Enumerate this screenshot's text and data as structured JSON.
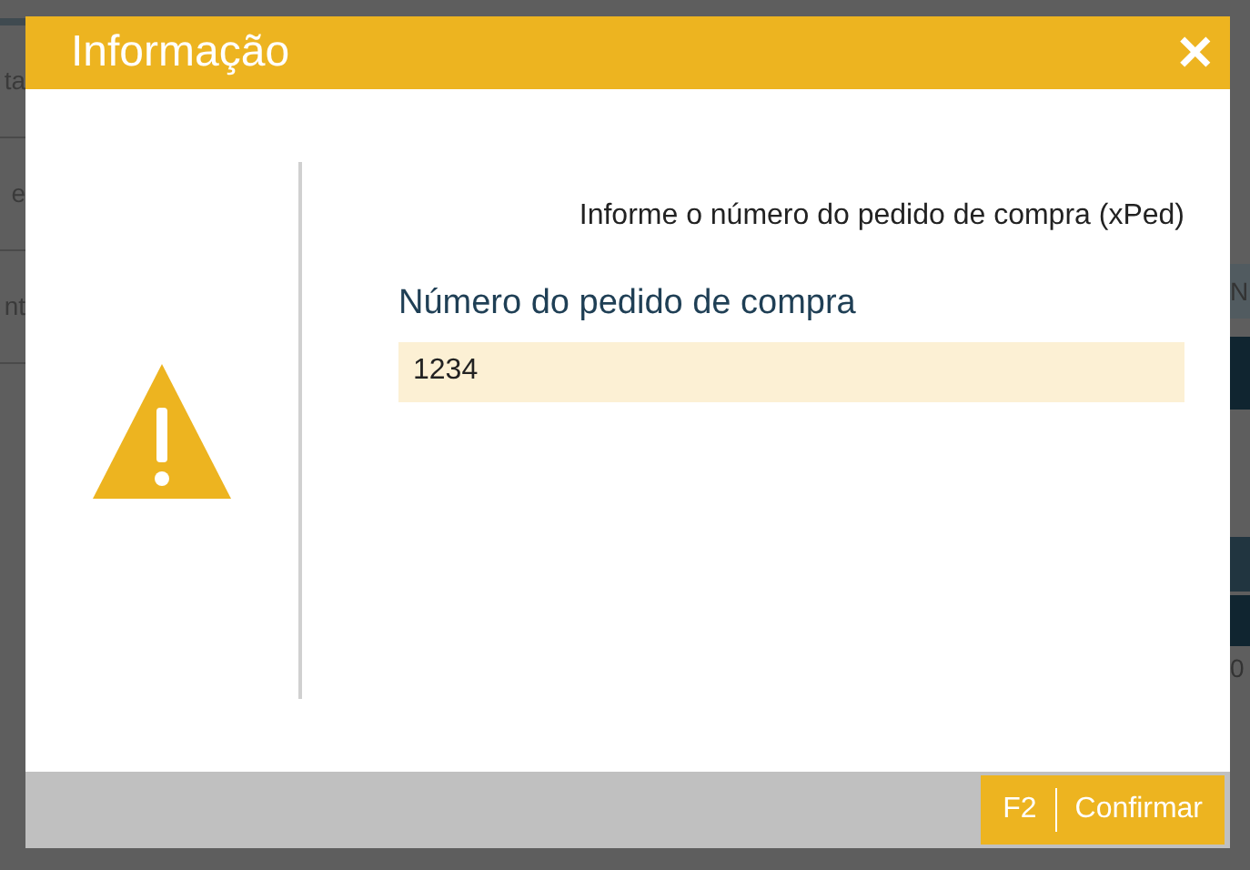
{
  "background": {
    "left_fragments": [
      "ta",
      "e",
      "nt"
    ],
    "right_fragments": [
      "N",
      "0"
    ]
  },
  "dialog": {
    "title": "Informação",
    "close": "✕",
    "message": "Informe o número do pedido de compra (xPed)",
    "field": {
      "label": "Número do pedido de compra",
      "value": "1234"
    },
    "buttons": [
      {
        "key": "F2",
        "label": "Confirmar"
      }
    ]
  }
}
